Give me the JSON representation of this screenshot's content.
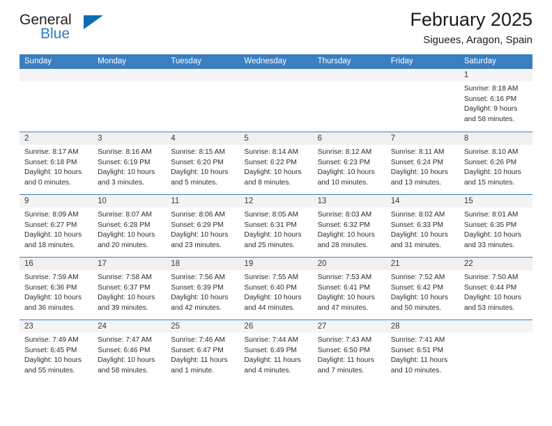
{
  "brand": {
    "name_part1": "General",
    "name_part2": "Blue"
  },
  "header": {
    "title": "February 2025",
    "location": "Siguees, Aragon, Spain"
  },
  "weekdays": [
    "Sunday",
    "Monday",
    "Tuesday",
    "Wednesday",
    "Thursday",
    "Friday",
    "Saturday"
  ],
  "colors": {
    "header_blue": "#3c7fc0",
    "brand_blue": "#2b7cc4",
    "triangle_blue": "#0b6cb1",
    "daynum_band": "#f4f4f4",
    "text": "#2b2b2b"
  },
  "weeks": [
    {
      "shaded": false,
      "days": [
        {
          "empty": true
        },
        {
          "empty": true
        },
        {
          "empty": true
        },
        {
          "empty": true
        },
        {
          "empty": true
        },
        {
          "empty": true
        },
        {
          "empty": false,
          "number": "1",
          "sunrise": "Sunrise: 8:18 AM",
          "sunset": "Sunset: 6:16 PM",
          "daylight": "Daylight: 9 hours and 58 minutes."
        }
      ]
    },
    {
      "shaded": true,
      "days": [
        {
          "empty": false,
          "number": "2",
          "sunrise": "Sunrise: 8:17 AM",
          "sunset": "Sunset: 6:18 PM",
          "daylight": "Daylight: 10 hours and 0 minutes."
        },
        {
          "empty": false,
          "number": "3",
          "sunrise": "Sunrise: 8:16 AM",
          "sunset": "Sunset: 6:19 PM",
          "daylight": "Daylight: 10 hours and 3 minutes."
        },
        {
          "empty": false,
          "number": "4",
          "sunrise": "Sunrise: 8:15 AM",
          "sunset": "Sunset: 6:20 PM",
          "daylight": "Daylight: 10 hours and 5 minutes."
        },
        {
          "empty": false,
          "number": "5",
          "sunrise": "Sunrise: 8:14 AM",
          "sunset": "Sunset: 6:22 PM",
          "daylight": "Daylight: 10 hours and 8 minutes."
        },
        {
          "empty": false,
          "number": "6",
          "sunrise": "Sunrise: 8:12 AM",
          "sunset": "Sunset: 6:23 PM",
          "daylight": "Daylight: 10 hours and 10 minutes."
        },
        {
          "empty": false,
          "number": "7",
          "sunrise": "Sunrise: 8:11 AM",
          "sunset": "Sunset: 6:24 PM",
          "daylight": "Daylight: 10 hours and 13 minutes."
        },
        {
          "empty": false,
          "number": "8",
          "sunrise": "Sunrise: 8:10 AM",
          "sunset": "Sunset: 6:26 PM",
          "daylight": "Daylight: 10 hours and 15 minutes."
        }
      ]
    },
    {
      "shaded": false,
      "days": [
        {
          "empty": false,
          "number": "9",
          "sunrise": "Sunrise: 8:09 AM",
          "sunset": "Sunset: 6:27 PM",
          "daylight": "Daylight: 10 hours and 18 minutes."
        },
        {
          "empty": false,
          "number": "10",
          "sunrise": "Sunrise: 8:07 AM",
          "sunset": "Sunset: 6:28 PM",
          "daylight": "Daylight: 10 hours and 20 minutes."
        },
        {
          "empty": false,
          "number": "11",
          "sunrise": "Sunrise: 8:06 AM",
          "sunset": "Sunset: 6:29 PM",
          "daylight": "Daylight: 10 hours and 23 minutes."
        },
        {
          "empty": false,
          "number": "12",
          "sunrise": "Sunrise: 8:05 AM",
          "sunset": "Sunset: 6:31 PM",
          "daylight": "Daylight: 10 hours and 25 minutes."
        },
        {
          "empty": false,
          "number": "13",
          "sunrise": "Sunrise: 8:03 AM",
          "sunset": "Sunset: 6:32 PM",
          "daylight": "Daylight: 10 hours and 28 minutes."
        },
        {
          "empty": false,
          "number": "14",
          "sunrise": "Sunrise: 8:02 AM",
          "sunset": "Sunset: 6:33 PM",
          "daylight": "Daylight: 10 hours and 31 minutes."
        },
        {
          "empty": false,
          "number": "15",
          "sunrise": "Sunrise: 8:01 AM",
          "sunset": "Sunset: 6:35 PM",
          "daylight": "Daylight: 10 hours and 33 minutes."
        }
      ]
    },
    {
      "shaded": true,
      "days": [
        {
          "empty": false,
          "number": "16",
          "sunrise": "Sunrise: 7:59 AM",
          "sunset": "Sunset: 6:36 PM",
          "daylight": "Daylight: 10 hours and 36 minutes."
        },
        {
          "empty": false,
          "number": "17",
          "sunrise": "Sunrise: 7:58 AM",
          "sunset": "Sunset: 6:37 PM",
          "daylight": "Daylight: 10 hours and 39 minutes."
        },
        {
          "empty": false,
          "number": "18",
          "sunrise": "Sunrise: 7:56 AM",
          "sunset": "Sunset: 6:39 PM",
          "daylight": "Daylight: 10 hours and 42 minutes."
        },
        {
          "empty": false,
          "number": "19",
          "sunrise": "Sunrise: 7:55 AM",
          "sunset": "Sunset: 6:40 PM",
          "daylight": "Daylight: 10 hours and 44 minutes."
        },
        {
          "empty": false,
          "number": "20",
          "sunrise": "Sunrise: 7:53 AM",
          "sunset": "Sunset: 6:41 PM",
          "daylight": "Daylight: 10 hours and 47 minutes."
        },
        {
          "empty": false,
          "number": "21",
          "sunrise": "Sunrise: 7:52 AM",
          "sunset": "Sunset: 6:42 PM",
          "daylight": "Daylight: 10 hours and 50 minutes."
        },
        {
          "empty": false,
          "number": "22",
          "sunrise": "Sunrise: 7:50 AM",
          "sunset": "Sunset: 6:44 PM",
          "daylight": "Daylight: 10 hours and 53 minutes."
        }
      ]
    },
    {
      "shaded": false,
      "days": [
        {
          "empty": false,
          "number": "23",
          "sunrise": "Sunrise: 7:49 AM",
          "sunset": "Sunset: 6:45 PM",
          "daylight": "Daylight: 10 hours and 55 minutes."
        },
        {
          "empty": false,
          "number": "24",
          "sunrise": "Sunrise: 7:47 AM",
          "sunset": "Sunset: 6:46 PM",
          "daylight": "Daylight: 10 hours and 58 minutes."
        },
        {
          "empty": false,
          "number": "25",
          "sunrise": "Sunrise: 7:46 AM",
          "sunset": "Sunset: 6:47 PM",
          "daylight": "Daylight: 11 hours and 1 minute."
        },
        {
          "empty": false,
          "number": "26",
          "sunrise": "Sunrise: 7:44 AM",
          "sunset": "Sunset: 6:49 PM",
          "daylight": "Daylight: 11 hours and 4 minutes."
        },
        {
          "empty": false,
          "number": "27",
          "sunrise": "Sunrise: 7:43 AM",
          "sunset": "Sunset: 6:50 PM",
          "daylight": "Daylight: 11 hours and 7 minutes."
        },
        {
          "empty": false,
          "number": "28",
          "sunrise": "Sunrise: 7:41 AM",
          "sunset": "Sunset: 6:51 PM",
          "daylight": "Daylight: 11 hours and 10 minutes."
        },
        {
          "empty": true
        }
      ]
    }
  ]
}
